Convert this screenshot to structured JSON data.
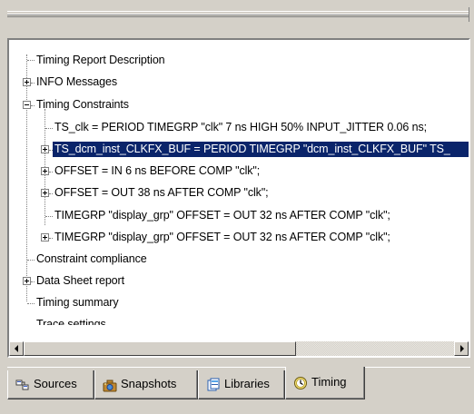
{
  "tree": {
    "items": [
      {
        "label": "Timing Report Description"
      },
      {
        "label": "INFO Messages"
      },
      {
        "label": "Timing Constraints"
      },
      {
        "label": "TS_clk = PERIOD TIMEGRP \"clk\" 7 ns HIGH 50% INPUT_JITTER 0.06 ns;"
      },
      {
        "label": "TS_dcm_inst_CLKFX_BUF = PERIOD TIMEGRP \"dcm_inst_CLKFX_BUF\" TS_"
      },
      {
        "label": "OFFSET = IN 6 ns BEFORE COMP \"clk\";"
      },
      {
        "label": "OFFSET = OUT 38 ns AFTER COMP \"clk\";"
      },
      {
        "label": "TIMEGRP \"display_grp\" OFFSET = OUT 32 ns AFTER COMP \"clk\";"
      },
      {
        "label": "TIMEGRP \"display_grp\" OFFSET = OUT 32 ns AFTER COMP \"clk\";"
      },
      {
        "label": "Constraint compliance"
      },
      {
        "label": "Data Sheet report"
      },
      {
        "label": "Timing summary"
      },
      {
        "label": "Trace settings"
      }
    ],
    "selected_index": 4
  },
  "tabs": [
    {
      "label": "Sources",
      "icon": "sources-icon"
    },
    {
      "label": "Snapshots",
      "icon": "snapshots-icon"
    },
    {
      "label": "Libraries",
      "icon": "libraries-icon"
    },
    {
      "label": "Timing",
      "icon": "timing-clock-icon",
      "active": true
    }
  ],
  "colors": {
    "window_bg": "#d4d0c8",
    "selection_bg": "#0a246a",
    "selection_fg": "#ffffff"
  }
}
